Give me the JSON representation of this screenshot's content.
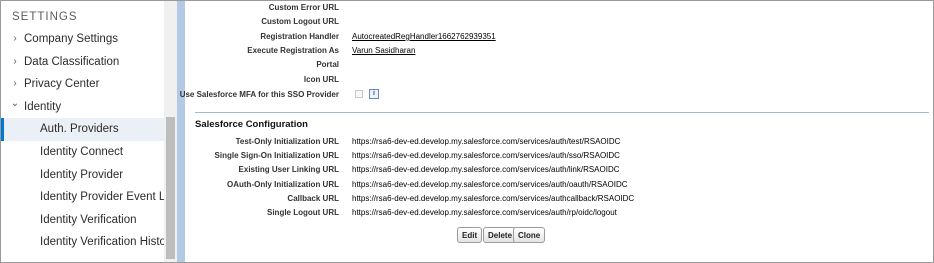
{
  "sidebar": {
    "heading": "SETTINGS",
    "items": [
      {
        "label": "Company Settings",
        "chevron": "›"
      },
      {
        "label": "Data Classification",
        "chevron": "›"
      },
      {
        "label": "Privacy Center",
        "chevron": "›"
      },
      {
        "label": "Identity",
        "chevron": "⌄"
      },
      {
        "label": "Auth. Providers"
      },
      {
        "label": "Identity Connect"
      },
      {
        "label": "Identity Provider"
      },
      {
        "label": "Identity Provider Event Log"
      },
      {
        "label": "Identity Verification"
      },
      {
        "label": "Identity Verification History"
      }
    ]
  },
  "details": {
    "custom_error_url": {
      "label": "Custom Error URL",
      "value": ""
    },
    "custom_logout_url": {
      "label": "Custom Logout URL",
      "value": ""
    },
    "registration_handler": {
      "label": "Registration Handler",
      "value": "AutocreatedRegHandler1662762939351"
    },
    "execute_registration_as": {
      "label": "Execute Registration As",
      "value": "Varun Sasidharan"
    },
    "portal": {
      "label": "Portal",
      "value": ""
    },
    "icon_url": {
      "label": "Icon URL",
      "value": ""
    },
    "use_mfa": {
      "label": "Use Salesforce MFA for this SSO Provider",
      "info": "i"
    }
  },
  "salesforce_configuration": {
    "title": "Salesforce Configuration",
    "rows": [
      {
        "label": "Test-Only Initialization URL",
        "value": "https://rsa6-dev-ed.develop.my.salesforce.com/services/auth/test/RSAOIDC"
      },
      {
        "label": "Single Sign-On Initialization URL",
        "value": "https://rsa6-dev-ed.develop.my.salesforce.com/services/auth/sso/RSAOIDC"
      },
      {
        "label": "Existing User Linking URL",
        "value": "https://rsa6-dev-ed.develop.my.salesforce.com/services/auth/link/RSAOIDC"
      },
      {
        "label": "OAuth-Only Initialization URL",
        "value": "https://rsa6-dev-ed.develop.my.salesforce.com/services/auth/oauth/RSAOIDC"
      },
      {
        "label": "Callback URL",
        "value": "https://rsa6-dev-ed.develop.my.salesforce.com/services/authcallback/RSAOIDC"
      },
      {
        "label": "Single Logout URL",
        "value": "https://rsa6-dev-ed.develop.my.salesforce.com/services/auth/rp/oidc/logout"
      }
    ]
  },
  "buttons": {
    "edit": "Edit",
    "delete": "Delete",
    "clone": "Clone"
  },
  "colors": {
    "accent_bar": "#b3c9e6",
    "active_nav": "#0176d3"
  }
}
